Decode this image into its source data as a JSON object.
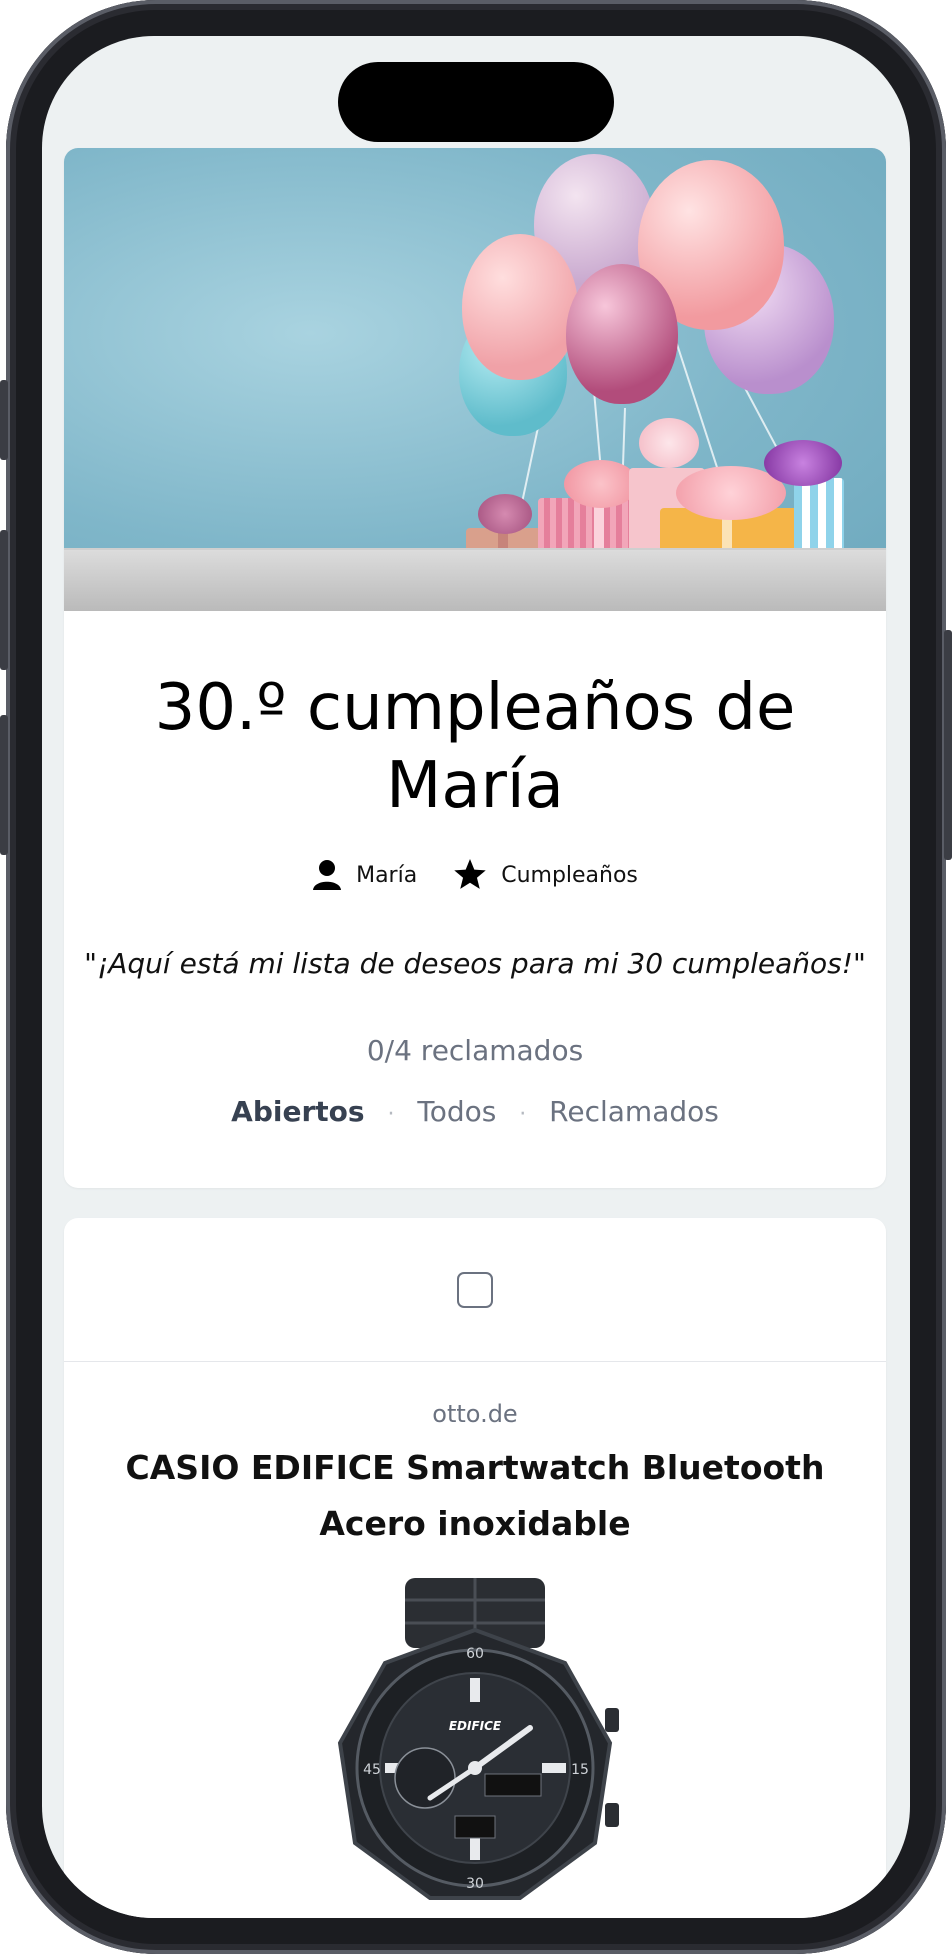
{
  "event": {
    "title": "30.º cumpleaños de María",
    "owner": "María",
    "category": "Cumpleaños",
    "description": "\"¡Aquí está mi lista de deseos para mi 30 cumpleaños!\"",
    "claimed_status": "0/4 reclamados",
    "filters": {
      "open": "Abiertos",
      "all": "Todos",
      "claimed": "Reclamados",
      "active": "Abiertos"
    }
  },
  "items": [
    {
      "checked": false,
      "store": "otto.de",
      "title": "CASIO EDIFICE Smartwatch Bluetooth Acero inoxidable",
      "image": "watch-image"
    }
  ],
  "icons": {
    "owner": "user-icon",
    "category": "star-icon"
  },
  "colors": {
    "page_background": "#edf1f2",
    "card_background": "#ffffff",
    "muted_text": "#6b7280",
    "active_filter": "#374151"
  }
}
